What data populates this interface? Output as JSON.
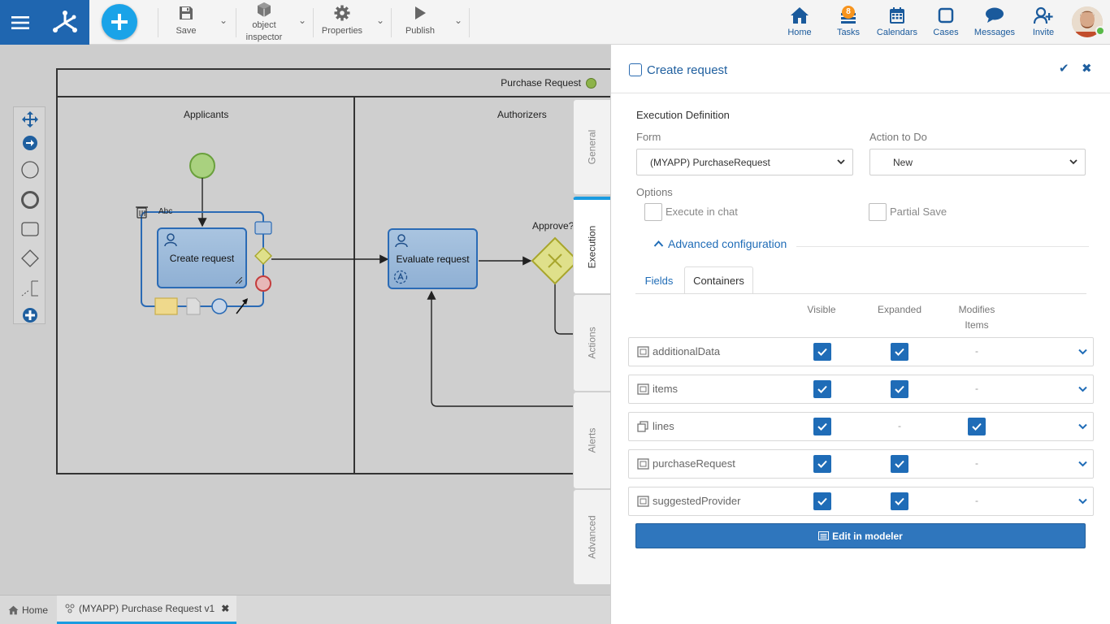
{
  "toolbar": {
    "save": "Save",
    "inspector_line1": "object",
    "inspector_line2": "inspector",
    "properties": "Properties",
    "publish": "Publish"
  },
  "nav": {
    "home": "Home",
    "tasks": "Tasks",
    "tasks_badge": "8",
    "calendars": "Calendars",
    "cases": "Cases",
    "messages": "Messages",
    "invite": "Invite"
  },
  "diagram": {
    "pool_title": "Purchase Request",
    "lane_applicants": "Applicants",
    "lane_authorizers": "Authorizers",
    "task_create": "Create request",
    "task_evaluate": "Evaluate request",
    "gateway_label": "Approve?",
    "text_tool": "Abc"
  },
  "bottom_tabs": {
    "home": "Home",
    "process": "(MYAPP) Purchase Request v1"
  },
  "vertical_tabs": [
    "General",
    "Execution",
    "Actions",
    "Alerts",
    "Advanced"
  ],
  "panel": {
    "title": "Create request",
    "section": "Execution Definition",
    "form_label": "Form",
    "form_value": "(MYAPP) PurchaseRequest",
    "action_label": "Action to Do",
    "action_value": "New",
    "options_label": "Options",
    "opt_chat": "Execute in chat",
    "opt_partial": "Partial Save",
    "advanced": "Advanced configuration",
    "tab_fields": "Fields",
    "tab_containers": "Containers",
    "col_visible": "Visible",
    "col_expanded": "Expanded",
    "col_modifies_1": "Modifies",
    "col_modifies_2": "Items",
    "rows": [
      {
        "name": "additionalData",
        "visible": true,
        "expanded": true,
        "modifies": "-"
      },
      {
        "name": "items",
        "visible": true,
        "expanded": true,
        "modifies": "-"
      },
      {
        "name": "lines",
        "visible": true,
        "expanded": "-",
        "modifies": true
      },
      {
        "name": "purchaseRequest",
        "visible": true,
        "expanded": true,
        "modifies": "-"
      },
      {
        "name": "suggestedProvider",
        "visible": true,
        "expanded": true,
        "modifies": "-"
      }
    ],
    "edit_button": "Edit in modeler"
  },
  "colors": {
    "brand_blue": "#1f66b0",
    "accent_blue": "#1f6cb7",
    "plus_button": "#1aa3e8",
    "badge_orange": "#f7941d"
  }
}
